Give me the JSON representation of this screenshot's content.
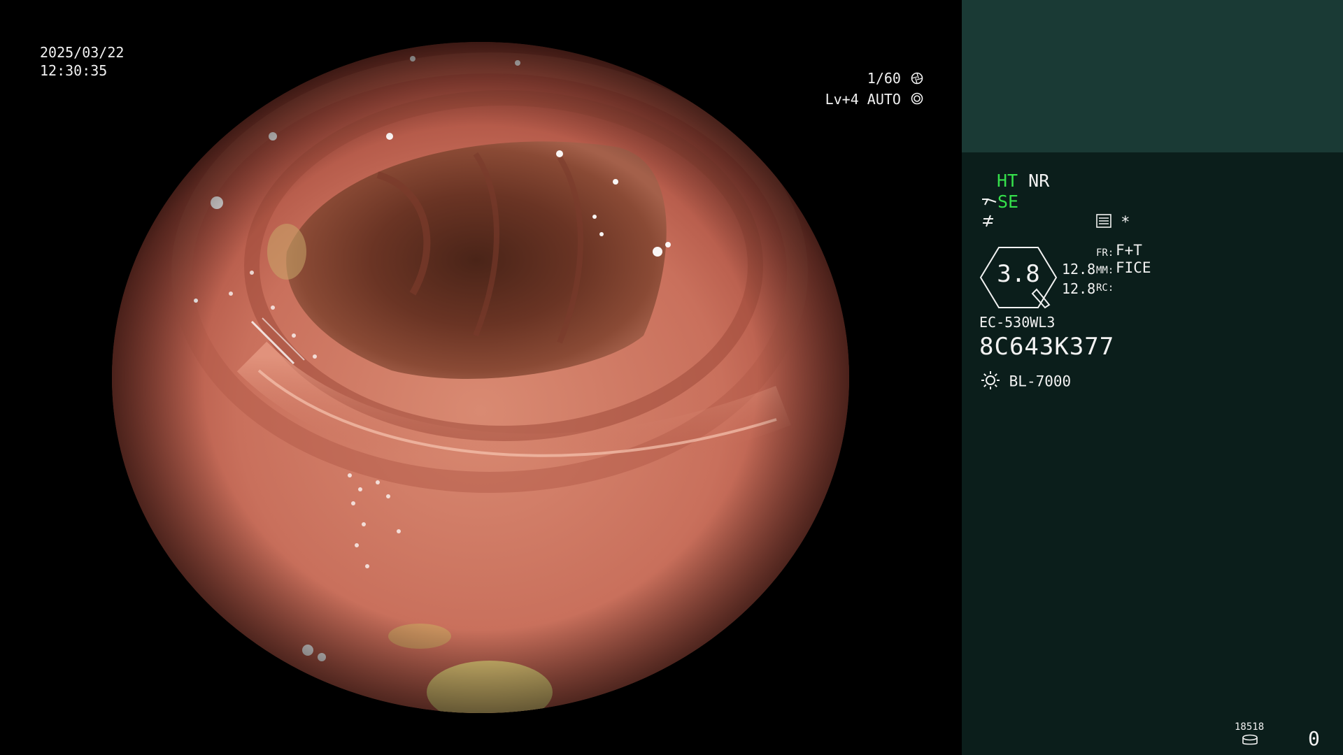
{
  "screen": {
    "date": "2025/03/22",
    "time": "12:30:35",
    "shutter": "1/60",
    "level": "Lv+4 AUTO"
  },
  "panel": {
    "mode_ht": "HT",
    "mode_nr": "NR",
    "mode_se": "SE",
    "star": "*",
    "gauge_value": "3.8",
    "param_values": [
      "12.8",
      "12.8"
    ],
    "param_labels": [
      "FR:",
      "MM:",
      "RC:"
    ],
    "param_modes": [
      "F+T",
      "FICE"
    ],
    "scope_model": "EC-530WL3",
    "scope_serial": "8C643K377",
    "light_source": "BL-7000",
    "image_counter": "18518",
    "record_count": "0"
  },
  "icons": {
    "shutter_icon": "aperture-icon",
    "level_icon": "target-ring-icon",
    "se_icon": "structure-enhance-icon",
    "edge_icon": "edge-icon",
    "menu_icon": "list-icon",
    "light_icon": "sun-icon",
    "storage_icon": "database-icon"
  },
  "colors": {
    "panel_bg": "#0b1e1b",
    "panel_band": "#1a3a35",
    "active_mode": "#35e04b",
    "text": "#f2f2f2"
  }
}
